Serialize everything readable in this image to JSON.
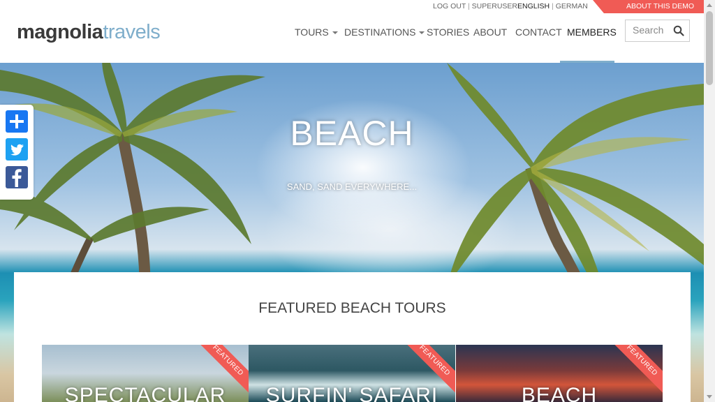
{
  "logo": {
    "part1": "magnolia",
    "part2": "travels"
  },
  "topbar": {
    "logout": "LOG OUT",
    "separator": "|",
    "user": "SUPERUSER",
    "lang_active": "ENGLISH",
    "lang_other": "GERMAN",
    "demo": "ABOUT THIS DEMO"
  },
  "nav": {
    "tours": "TOURS",
    "destinations": "DESTINATIONS",
    "stories": "STORIES",
    "about": "ABOUT",
    "contact": "CONTACT",
    "members": "MEMBERS"
  },
  "search": {
    "placeholder": "Search"
  },
  "hero": {
    "title": "BEACH",
    "subtitle": "SAND, SAND EVERYWHERE..."
  },
  "share": {
    "icons": [
      "plus-icon",
      "twitter-icon",
      "facebook-icon"
    ]
  },
  "section": {
    "title": "FEATURED BEACH TOURS"
  },
  "tiles": [
    {
      "title": "SPECTACULAR",
      "badge": "FEATURED"
    },
    {
      "title": "SURFIN' SAFARI",
      "badge": "FEATURED"
    },
    {
      "title": "BEACH",
      "badge": "FEATURED"
    }
  ],
  "colors": {
    "accent": "#f05b55",
    "brand_blue": "#7faecb",
    "twitter": "#1da1f2",
    "facebook": "#3b5998",
    "share": "#1877f2"
  }
}
